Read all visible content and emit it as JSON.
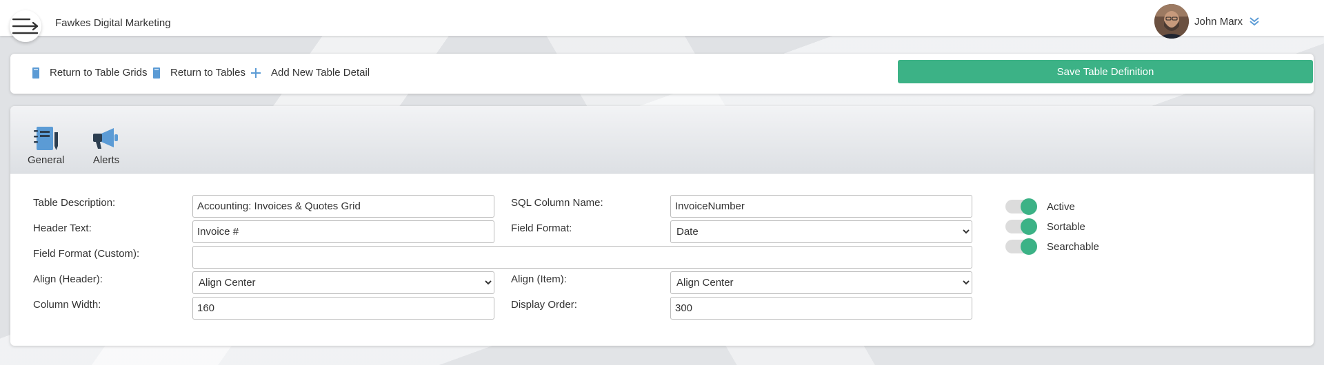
{
  "app": {
    "title": "Fawkes Digital Marketing"
  },
  "user": {
    "name": "John Marx"
  },
  "actions": {
    "return_grids": "Return to Table Grids",
    "return_tables": "Return to Tables",
    "add_detail": "Add New Table Detail",
    "save": "Save Table Definition"
  },
  "tabs": [
    {
      "label": "General"
    },
    {
      "label": "Alerts"
    }
  ],
  "form": {
    "table_description": {
      "label": "Table Description:",
      "value": "Accounting: Invoices & Quotes Grid"
    },
    "sql_column_name": {
      "label": "SQL Column Name:",
      "value": "InvoiceNumber"
    },
    "header_text": {
      "label": "Header Text:",
      "value": "Invoice #"
    },
    "field_format": {
      "label": "Field Format:",
      "value": "Date"
    },
    "field_format_custom": {
      "label": "Field Format (Custom):",
      "value": ""
    },
    "align_header": {
      "label": "Align (Header):",
      "value": "Align Center"
    },
    "align_item": {
      "label": "Align (Item):",
      "value": "Align Center"
    },
    "column_width": {
      "label": "Column Width:",
      "value": "160"
    },
    "display_order": {
      "label": "Display Order:",
      "value": "300"
    }
  },
  "toggles": {
    "active": {
      "label": "Active",
      "on": true
    },
    "sortable": {
      "label": "Sortable",
      "on": true
    },
    "searchable": {
      "label": "Searchable",
      "on": true
    }
  },
  "colors": {
    "accent": "#3cb286",
    "icon_blue": "#5b9bd5"
  }
}
